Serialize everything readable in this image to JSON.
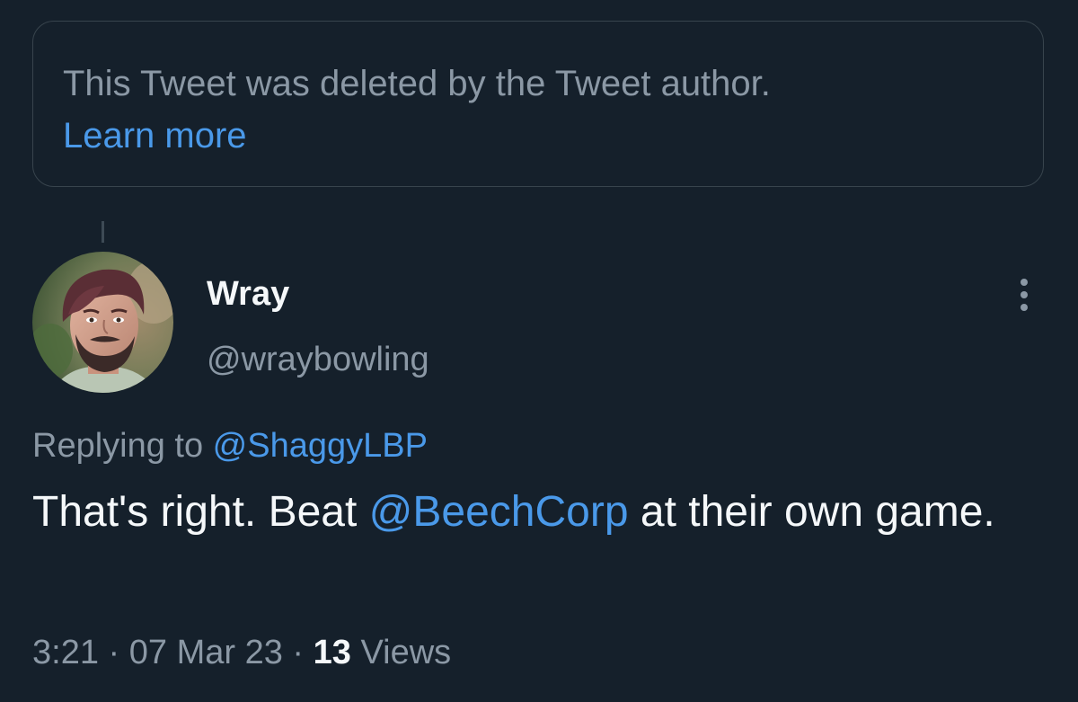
{
  "deleted_notice": {
    "text": "This Tweet was deleted by the Tweet author.",
    "link_label": "Learn more"
  },
  "tweet": {
    "author": {
      "display_name": "Wray",
      "handle": "@wraybowling"
    },
    "reply": {
      "prefix": "Replying to ",
      "mention": "@ShaggyLBP"
    },
    "text": {
      "part1": "That's right. Beat ",
      "mention": "@BeechCorp",
      "part2": " at their own game."
    },
    "meta": {
      "time": "3:21",
      "separator": " · ",
      "date": "07 Mar 23",
      "views_count": "13",
      "views_label": " Views"
    }
  },
  "icons": {
    "more": "more-vertical-icon",
    "avatar": "user-avatar"
  },
  "colors": {
    "background": "#15202b",
    "border": "#38444d",
    "muted_text": "#8b98a5",
    "primary_text": "#f5f8fa",
    "link": "#4a99e9"
  }
}
